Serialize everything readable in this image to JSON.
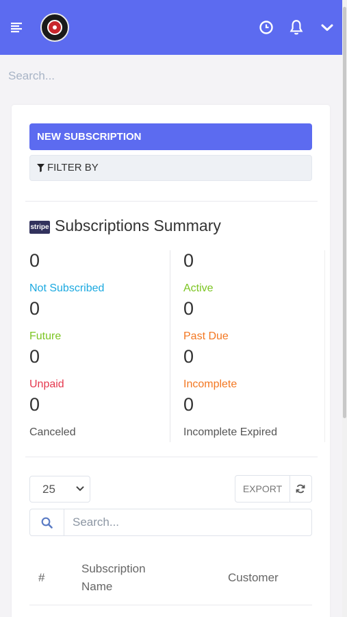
{
  "header": {
    "menu_icon": "menu-icon",
    "logo_icon": "business-logo",
    "clock_icon": "clock-icon",
    "bell_icon": "bell-icon",
    "chevron_icon": "chevron-down-icon",
    "bar_color": "#5c6bf0"
  },
  "search": {
    "placeholder": "Search..."
  },
  "actions": {
    "new_subscription": "NEW SUBSCRIPTION",
    "filter_by": "FILTER BY"
  },
  "summary": {
    "logo_text": "stripe",
    "title": "Subscriptions Summary",
    "stats": [
      {
        "value": "0",
        "label": "Not Subscribed",
        "color": "#1ba9e0"
      },
      {
        "value": "0",
        "label": "Active",
        "color": "#7cc522"
      },
      {
        "value": "0",
        "label": "Future",
        "color": "#7cc522"
      },
      {
        "value": "0",
        "label": "Past Due",
        "color": "#f37721"
      },
      {
        "value": "0",
        "label": "Unpaid",
        "color": "#e5384e"
      },
      {
        "value": "0",
        "label": "Incomplete",
        "color": "#f37721"
      },
      {
        "value": "0",
        "label": "Canceled",
        "color": "#555555"
      },
      {
        "value": "0",
        "label": "Incomplete Expired",
        "color": "#555555"
      }
    ]
  },
  "table": {
    "per_page": "25",
    "export_label": "EXPORT",
    "search_placeholder": "Search...",
    "columns": [
      "#",
      "Subscription Name",
      "Customer"
    ]
  }
}
